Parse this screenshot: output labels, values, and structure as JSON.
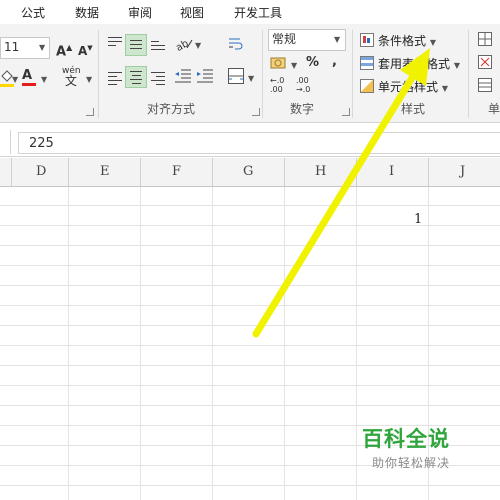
{
  "tabs": [
    "公式",
    "数据",
    "审阅",
    "视图",
    "开发工具"
  ],
  "font": {
    "size_value": "11",
    "grow_icon": "font-grow-icon",
    "shrink_icon": "font-shrink-icon",
    "fill_color": "#ffd700",
    "font_color": "#e51c1c",
    "phonetic_label": "wén"
  },
  "alignment": {
    "group_label": "对齐方式"
  },
  "number": {
    "format_value": "常规",
    "percent": "%",
    "comma": ",",
    "group_label": "数字"
  },
  "styles": {
    "conditional_format": "条件格式",
    "table_format": "套用表格格式",
    "cell_styles": "单元格样式",
    "group_label": "样式"
  },
  "cells_group_partial": "单",
  "formula_bar": {
    "value": "225"
  },
  "columns": [
    "D",
    "E",
    "F",
    "G",
    "H",
    "I",
    "J"
  ],
  "sheet": {
    "i_row2_value": "1"
  },
  "watermark": {
    "title": "百科全说",
    "subtitle": "助你轻松解决"
  },
  "annotation_color": "#f0f200"
}
